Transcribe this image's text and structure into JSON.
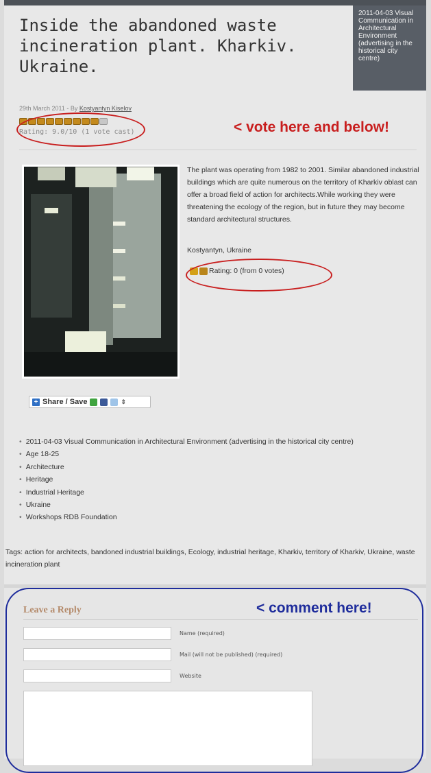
{
  "post": {
    "title": "Inside the abandoned waste incineration plant. Kharkiv. Ukraine.",
    "date_box": "2011-04-03 Visual Communication in Architectural Environment (advertising in the historical city centre)",
    "byline_prefix": "29th March 2011 - By",
    "author": "Kostyantyn Kiselov"
  },
  "rating_top": {
    "stars": 9.0,
    "max": 10,
    "text": "Rating: 9.0/10 (1 vote cast)"
  },
  "annotations": {
    "vote": "< vote here and below!",
    "comment": "< comment here!",
    "vote_color": "#c81e1e",
    "comment_color": "#1f2d9c"
  },
  "content": {
    "description": "The plant was operating  from 1982 to 2001. Similar abandoned industrial buildings which are quite numerous on the territory of Kharkiv oblast can offer a broad field of action for architects.While working they were  threatening the ecology of the region, but in future they may become standard architectural  structures.",
    "place": "Kostyantyn, Ukraine",
    "rating": "Rating: 0 (from 0 votes)"
  },
  "share": {
    "label": "Share / Save",
    "icons": [
      "share-icon",
      "facebook-icon",
      "twitter-icon"
    ]
  },
  "categories": [
    "2011-04-03 Visual Communication in Architectural Environment (advertising in the historical city centre)",
    "Age 18-25",
    "Architecture",
    "Heritage",
    "Industrial Heritage",
    "Ukraine",
    "Workshops RDB Foundation"
  ],
  "tags": "Tags: action for architects, bandoned industrial buildings, Ecology, industrial heritage, Kharkiv, territory of Kharkiv, Ukraine, waste incineration plant",
  "reply": {
    "title": "Leave a Reply",
    "name_label": "Name (required)",
    "mail_label": "Mail (will not be published) (required)",
    "website_label": "Website",
    "name_value": "",
    "mail_value": "",
    "website_value": "",
    "comment_value": ""
  }
}
